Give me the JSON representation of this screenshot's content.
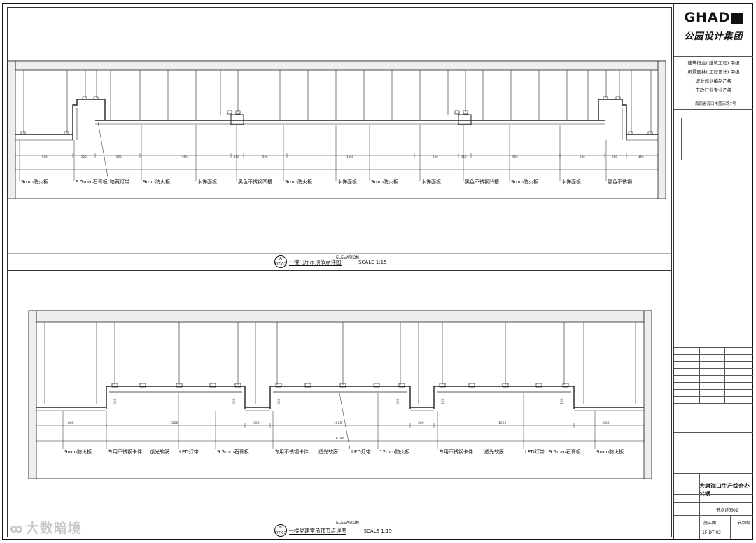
{
  "title_block": {
    "logo_text": "GHAD",
    "company_name": "公园设计集团",
    "qualifications": [
      "建筑行业( 建筑工程) 甲级",
      "风景园林( 工程设计) 甲级",
      "城乡规划编制乙级",
      "市政行业专业乙级"
    ],
    "address": "海南省海口市蓝天路7号",
    "project_name": "大唐海口生产综合办公楼",
    "drawing_name": "节点详图02",
    "status_1": "施工图",
    "status_2": "节点图",
    "drawing_number": "1F-DT-02"
  },
  "elevation_a": {
    "bubble_letter": "A",
    "bubble_code": "DT-02",
    "heading": "ELEVATION",
    "caption": "一楼门厅吊顶节点详图",
    "scale": "SCALE 1:15",
    "labels": [
      "9mm防火板",
      "9.5mm石膏板",
      "暗藏灯带",
      "9mm防火板",
      "木饰面板",
      "黑色不锈钢凹槽",
      "9mm防火板",
      "木饰面板",
      "9mm防火板",
      "木饰面板",
      "黑色不锈钢凹槽",
      "9mm防火板",
      "木饰面板",
      "黑色不锈钢"
    ],
    "dims": [
      "500",
      "200",
      "500",
      "950",
      "150",
      "500",
      "1400",
      "500",
      "150",
      "950",
      "500",
      "200",
      "450"
    ]
  },
  "elevation_b": {
    "bubble_letter": "B",
    "bubble_code": "DT-02",
    "heading": "ELEVATION",
    "caption": "一楼党建室吊顶节点详图",
    "scale": "SCALE 1:15",
    "labels": [
      "9mm防火板",
      "专用不锈钢卡件",
      "透光软膜",
      "LED灯带",
      "9.5mm石膏板",
      "专用不锈钢卡件",
      "透光软膜",
      "LED灯带",
      "12mm防火板",
      "专用不锈钢卡件",
      "透光软膜",
      "LED灯带",
      "9.5mm石膏板",
      "9mm防火板"
    ],
    "dims": [
      "800",
      "1525",
      "300",
      "1525",
      "300",
      "1525",
      "800"
    ],
    "overall": "6790",
    "height_dims": [
      "200",
      "200",
      "200",
      "200",
      "200",
      "200"
    ]
  },
  "watermark": "大数暗境"
}
